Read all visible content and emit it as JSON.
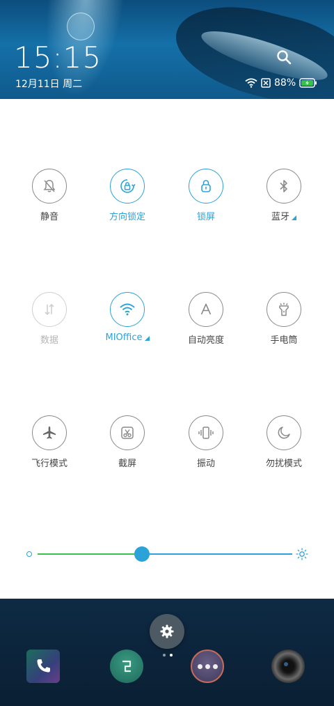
{
  "status_bar": {
    "time": "15:15",
    "date": "12月11日 周二",
    "battery": "88%"
  },
  "tiles": [
    {
      "id": "mute",
      "label": "静音",
      "icon": "bell-off-icon",
      "state": "inactive"
    },
    {
      "id": "rotation-lock",
      "label": "方向锁定",
      "icon": "rotation-lock-icon",
      "state": "active"
    },
    {
      "id": "lock-screen",
      "label": "锁屏",
      "icon": "lock-icon",
      "state": "active"
    },
    {
      "id": "bluetooth",
      "label": "蓝牙",
      "icon": "bluetooth-icon",
      "state": "inactive",
      "has_menu": true
    },
    {
      "id": "data",
      "label": "数据",
      "icon": "data-arrows-icon",
      "state": "disabled"
    },
    {
      "id": "wifi",
      "label": "MIOffice",
      "icon": "wifi-icon",
      "state": "active",
      "has_menu": true
    },
    {
      "id": "auto-brightness",
      "label": "自动亮度",
      "icon": "auto-brightness-icon",
      "state": "inactive"
    },
    {
      "id": "flashlight",
      "label": "手电筒",
      "icon": "flashlight-icon",
      "state": "inactive"
    },
    {
      "id": "airplane",
      "label": "飞行模式",
      "icon": "airplane-icon",
      "state": "inactive"
    },
    {
      "id": "screenshot",
      "label": "截屏",
      "icon": "screenshot-icon",
      "state": "inactive"
    },
    {
      "id": "vibrate",
      "label": "振动",
      "icon": "vibrate-icon",
      "state": "inactive"
    },
    {
      "id": "dnd",
      "label": "勿扰模式",
      "icon": "moon-icon",
      "state": "inactive"
    }
  ],
  "brightness": {
    "level": 0.41
  },
  "colors": {
    "accent": "#2ba3d8",
    "inactive": "#8a8a8a",
    "disabled": "#cfcfcf",
    "brightness_fill": "#3cc150"
  },
  "dock": {
    "page_count": 2,
    "current_page": 1,
    "apps": [
      "phone-icon",
      "app-store-icon",
      "more-icon",
      "camera-icon"
    ]
  }
}
